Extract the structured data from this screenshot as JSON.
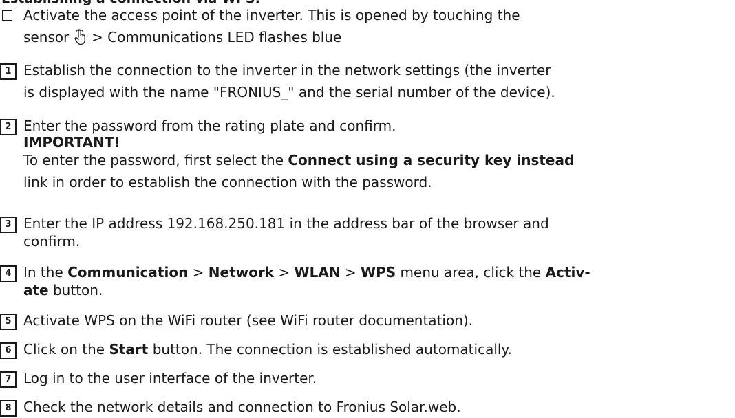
{
  "heading": "Establishing a connection via WPS:",
  "precondition": {
    "pre": "Activate the access point of the inverter. This is opened by touching the",
    "line2_pre": "sensor",
    "line2_post": " > Communications LED flashes blue"
  },
  "steps": [
    {
      "num": "1",
      "l1": "Establish the connection to the inverter in the network settings (the inverter",
      "l2": "is displayed with the name \"FRONIUS_\" and the serial number of the device)."
    },
    {
      "num": "2",
      "l1": "Enter the password from the rating plate and confirm.",
      "important": "IMPORTANT!",
      "l3": "To enter the password, first select the ",
      "l3_bold": "Connect using a security key instead",
      "l4": "link in order to establish the connection with the password."
    },
    {
      "num": "3",
      "l1": "Enter the IP address 192.168.250.181 in the address bar of the browser and",
      "l2": "confirm."
    },
    {
      "num": "4",
      "a": "In the ",
      "b1": "Communication",
      "sep1": " > ",
      "b2": "Network",
      "sep2": " > ",
      "b3": "WLAN",
      "sep3": " > ",
      "b4": "WPS",
      "c": " menu area, click the ",
      "b5": "Activ-",
      "l2_bold": "ate",
      "l2": " button."
    },
    {
      "num": "5",
      "l1": "Activate WPS on the WiFi router (see WiFi router documentation)."
    },
    {
      "num": "6",
      "a": "Click on the ",
      "b": "Start",
      "c": " button. The connection is established automatically."
    },
    {
      "num": "7",
      "l1": "Log in to the user interface of the inverter."
    },
    {
      "num": "8",
      "l1": "Check the network details and connection to Fronius Solar.web."
    }
  ]
}
